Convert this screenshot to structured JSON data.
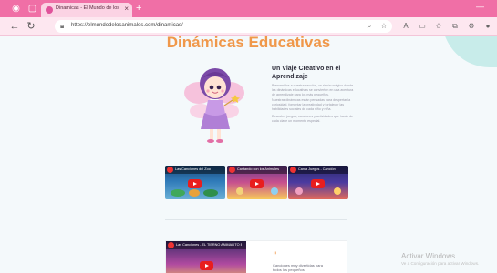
{
  "browser": {
    "tab_title": "Dinamicas - El Mundo de los Ani...",
    "tab_close": "×",
    "new_tab": "+",
    "url": "https://elmundodelosanimales.com/dinamicas/",
    "window_minimize": "—"
  },
  "page": {
    "title": "Dinámicas Educativas",
    "section_title": "Un Viaje Creativo en el Aprendizaje",
    "paragraphs": [
      "Bienvenidos a nuestra sección, un rincón mágico donde las dinámicas educativas se convierten en una aventura de aprendizaje para los más pequeños.",
      "Nuestras dinámicas están pensadas para despertar la curiosidad, fomentar la creatividad y fortalecer las habilidades sociales de cada niño y niña.",
      "Descubre juegos, canciones y actividades que harán de cada clase un momento especial."
    ],
    "videos": [
      {
        "title": "Las Canciones del Zoo"
      },
      {
        "title": "Cantando con los Animales"
      },
      {
        "title": "Canta Juegos - Canción"
      }
    ],
    "card": {
      "video_title": "Las Canciones - EL TIERNO ANIMALITO BAILA",
      "quote_mark": "\"",
      "quote_text": "Canciones muy divertidas para todos los pequeños"
    }
  },
  "windows_notice": {
    "title": "Activar Windows",
    "subtitle": "Ve a Configuración para activar Windows."
  },
  "colors": {
    "tab_bar": "#f06fa6",
    "address_bar": "#fde7f0",
    "title_orange": "#f0984a",
    "youtube_red": "#e81e1e",
    "deco_teal": "#c8ecea"
  }
}
